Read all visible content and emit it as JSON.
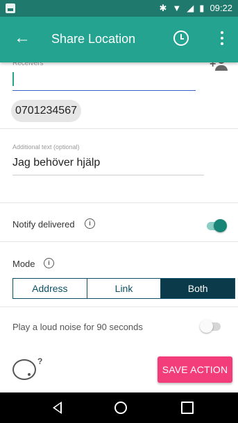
{
  "status_bar": {
    "time": "09:22",
    "icons": [
      "image-icon",
      "bluetooth-icon",
      "wifi-icon",
      "signal-icon",
      "battery-icon"
    ]
  },
  "app_bar": {
    "title": "Share Location",
    "icons": [
      "back-arrow-icon",
      "clock-icon",
      "more-vert-icon"
    ],
    "color": "#23a390"
  },
  "receivers": {
    "label": "Receivers",
    "value": "",
    "chip": "0701234567"
  },
  "additional_text": {
    "label": "Additional text (optional)",
    "value": "Jag behöver hjälp"
  },
  "notify_delivered": {
    "label": "Notify delivered",
    "enabled": true
  },
  "mode": {
    "label": "Mode",
    "options": [
      "Address",
      "Link",
      "Both"
    ],
    "selected": "Both"
  },
  "loud_noise": {
    "label": "Play a loud noise for 90 seconds",
    "enabled": false
  },
  "save_action": {
    "label": "SAVE ACTION",
    "color": "#f23d7a"
  },
  "nav_bar": {
    "icons": [
      "nav-back-icon",
      "nav-home-icon",
      "nav-recent-icon"
    ]
  }
}
